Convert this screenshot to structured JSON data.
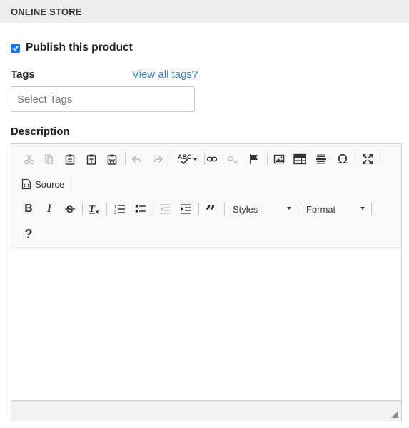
{
  "section": {
    "title": "ONLINE STORE"
  },
  "publish": {
    "label": "Publish this product",
    "checked": true
  },
  "tags": {
    "label": "Tags",
    "link": "View all tags?",
    "placeholder": "Select Tags"
  },
  "description": {
    "label": "Description",
    "source_label": "Source",
    "styles_label": "Styles",
    "format_label": "Format",
    "help_glyph": "?",
    "special_char_glyph": "Ω",
    "spell_glyph": "ABC"
  }
}
